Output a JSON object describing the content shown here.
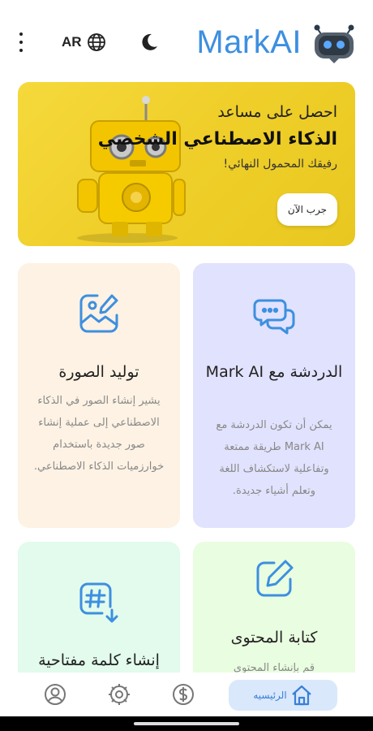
{
  "header": {
    "language": "AR",
    "brand_title": "MarkAI"
  },
  "hero": {
    "line1": "احصل على مساعد",
    "line2": "الذكاء الاصطناعي الشخصي",
    "line3": "رفيقك المحمول النهائي!",
    "button_label": "جرب الآن"
  },
  "cards": {
    "chat": {
      "title": "الدردشة مع Mark AI",
      "description": "يمكن أن تكون الدردشة مع Mark AI طريقة ممتعة وتفاعلية لاستكشاف اللغة وتعلم أشياء جديدة."
    },
    "image": {
      "title": "توليد الصورة",
      "description": "يشير إنشاء الصور في الذكاء الاصطناعي إلى عملية إنشاء صور جديدة باستخدام خوارزميات الذكاء الاصطناعي."
    },
    "content": {
      "title": "كتابة المحتوى",
      "description": "قم بإنشاء المحتوى"
    },
    "keyword": {
      "title": "إنشاء كلمة مفتاحية"
    }
  },
  "bottom_nav": {
    "home_label": "الرئيسيه",
    "items": [
      "profile-icon",
      "settings-icon",
      "dollar-icon",
      "home-icon"
    ]
  },
  "colors": {
    "accent": "#3d8fe0",
    "hero_bg": "#f2d22e",
    "card_chat_bg": "#e1e2fd",
    "card_image_bg": "#fdf2e3",
    "card_keyword_bg": "#e2fbec",
    "card_content_bg": "#e9fde0"
  }
}
